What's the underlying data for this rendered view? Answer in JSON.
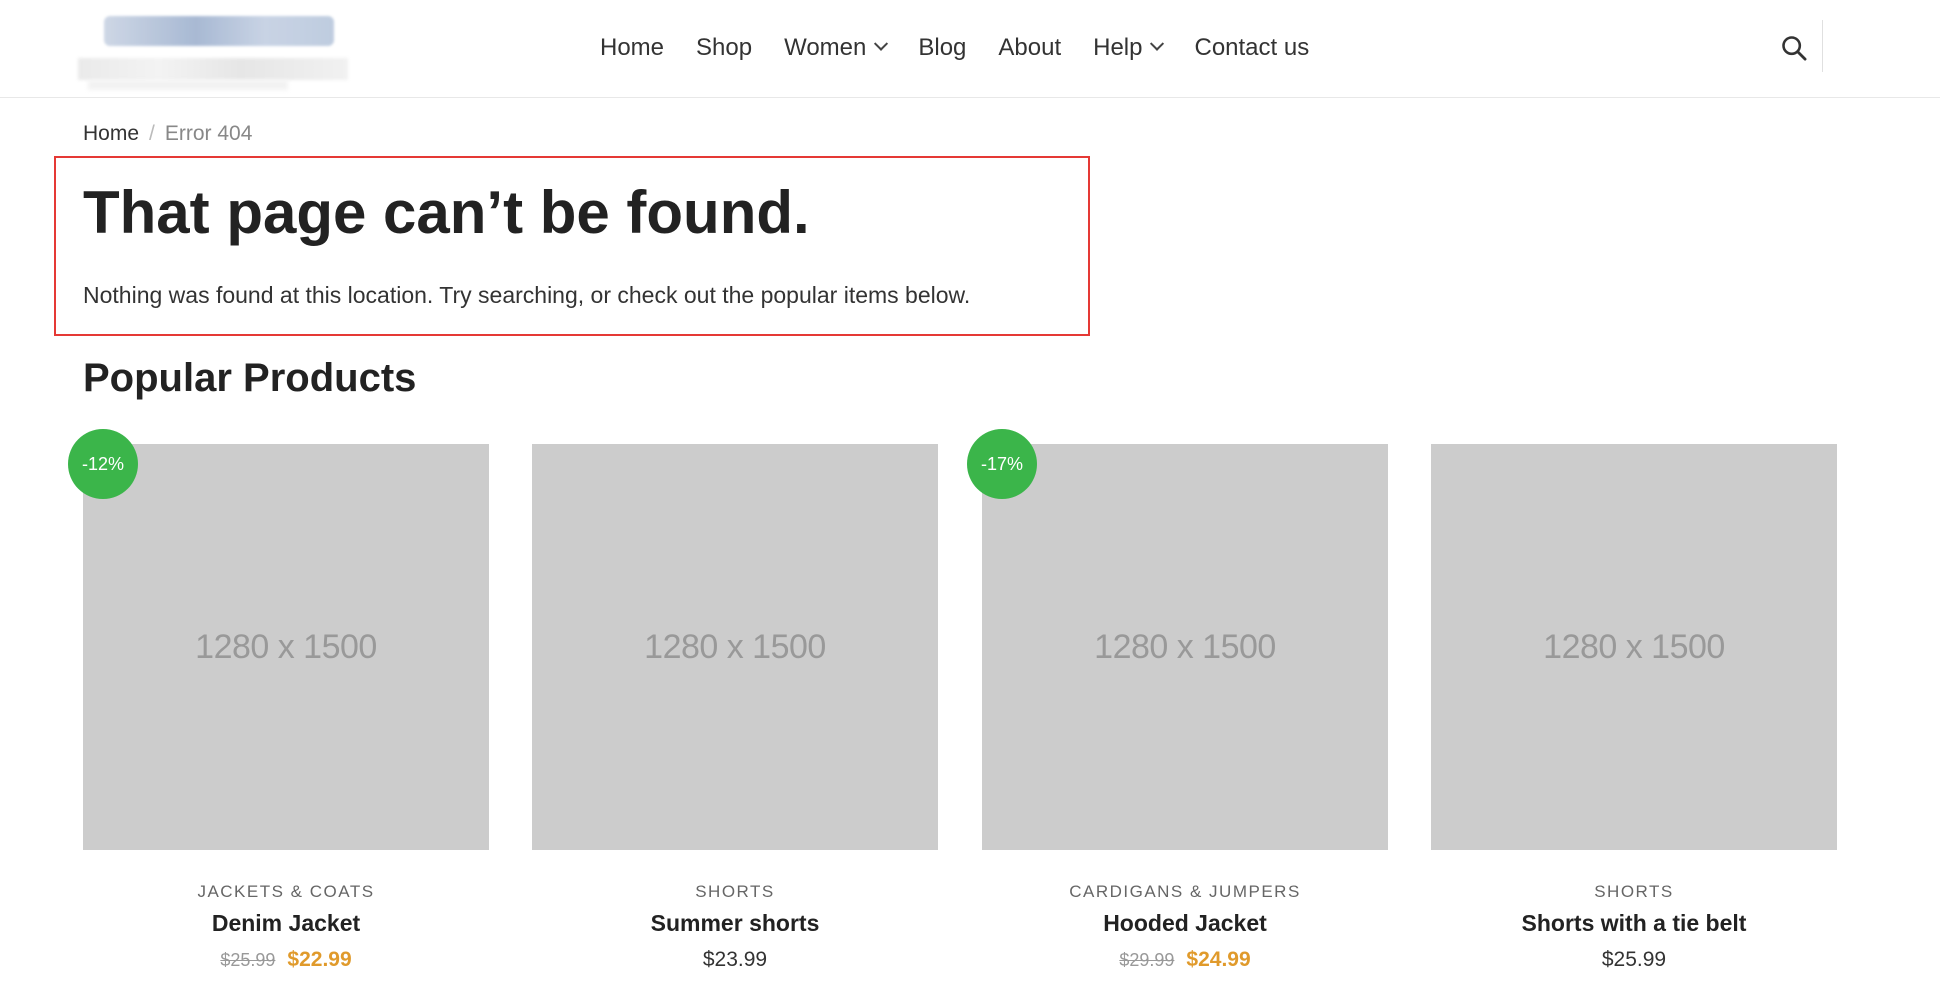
{
  "nav": {
    "items": [
      {
        "label": "Home",
        "has_dropdown": false
      },
      {
        "label": "Shop",
        "has_dropdown": false
      },
      {
        "label": "Women",
        "has_dropdown": true
      },
      {
        "label": "Blog",
        "has_dropdown": false
      },
      {
        "label": "About",
        "has_dropdown": false
      },
      {
        "label": "Help",
        "has_dropdown": true
      },
      {
        "label": "Contact us",
        "has_dropdown": false
      }
    ]
  },
  "breadcrumb": {
    "home": "Home",
    "separator": "/",
    "current": "Error 404"
  },
  "error": {
    "title": "That page can’t be found.",
    "description": "Nothing was found at this location. Try searching, or check out the popular items below."
  },
  "popular": {
    "title": "Popular Products",
    "products": [
      {
        "badge": "-12%",
        "image_text": "1280 x 1500",
        "category": "JACKETS & COATS",
        "name": "Denim Jacket",
        "old_price": "$25.99",
        "price": "$22.99"
      },
      {
        "badge": "",
        "image_text": "1280 x 1500",
        "category": "SHORTS",
        "name": "Summer shorts",
        "old_price": "",
        "price": "$23.99"
      },
      {
        "badge": "-17%",
        "image_text": "1280 x 1500",
        "category": "CARDIGANS & JUMPERS",
        "name": "Hooded Jacket",
        "old_price": "$29.99",
        "price": "$24.99"
      },
      {
        "badge": "",
        "image_text": "1280 x 1500",
        "category": "SHORTS",
        "name": "Shorts with a tie belt",
        "old_price": "",
        "price": "$25.99"
      }
    ]
  },
  "colors": {
    "accent_sale": "#e09a2b",
    "badge": "#3bb54a",
    "highlight_border": "#e53935",
    "placeholder": "#cccccc"
  }
}
